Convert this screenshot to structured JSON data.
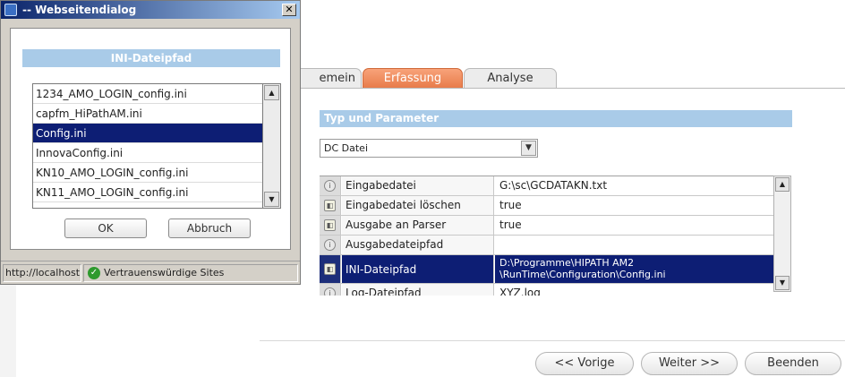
{
  "tabs": [
    {
      "label": "emein"
    },
    {
      "label": "Erfassung"
    },
    {
      "label": "Analyse"
    }
  ],
  "section": {
    "title": "Typ und Parameter"
  },
  "type_select": {
    "value": "DC Datei"
  },
  "params": [
    {
      "icon": "info-icon",
      "name": "Eingabedatei",
      "value": "G:\\sc\\GCDATAKN.txt"
    },
    {
      "icon": "toggle-icon",
      "name": "Eingabedatei löschen",
      "value": "true"
    },
    {
      "icon": "toggle-icon",
      "name": "Ausgabe an Parser",
      "value": "true"
    },
    {
      "icon": "info-icon",
      "name": "Ausgabedateipfad",
      "value": ""
    },
    {
      "icon": "toggle-icon",
      "name": "INI-Dateipfad",
      "value_line1": "D:\\Programme\\HIPATH AM2",
      "value_line2": "\\RunTime\\Configuration\\Config.ini"
    },
    {
      "icon": "info-icon",
      "name": "Log-Dateipfad",
      "value": "XYZ.log"
    }
  ],
  "nav": {
    "prev": "<< Vorige",
    "next": "Weiter >>",
    "end": "Beenden"
  },
  "dialog": {
    "title": "-- Webseitendialog",
    "header": "INI-Dateipfad",
    "files": [
      "1234_AMO_LOGIN_config.ini",
      "capfm_HiPathAM.ini",
      "Config.ini",
      "InnovaConfig.ini",
      "KN10_AMO_LOGIN_config.ini",
      "KN11_AMO_LOGIN_config.ini"
    ],
    "selected_file": "Config.ini",
    "ok_label": "OK",
    "cancel_label": "Abbruch",
    "status_url": "http://localhost",
    "status_zone": "Vertrauenswürdige Sites"
  },
  "colors": {
    "accent_tab": "#e77a48",
    "selection": "#0d1e74",
    "header_blue": "#a9cbe8"
  }
}
